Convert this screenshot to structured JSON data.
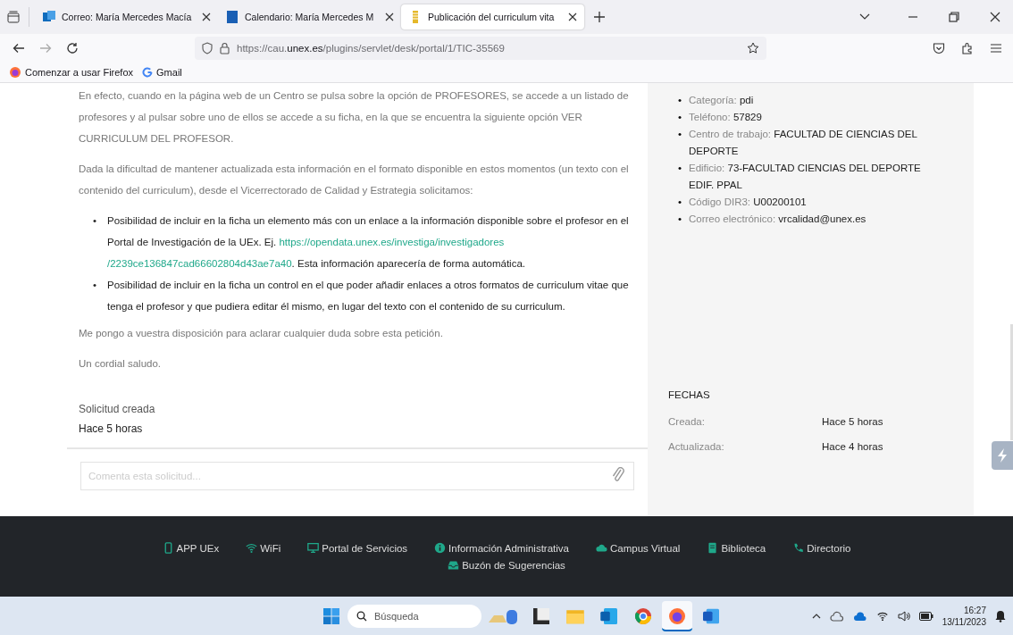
{
  "browser": {
    "tabs": [
      {
        "title": "Correo: María Mercedes Macía",
        "selected": false
      },
      {
        "title": "Calendario: María Mercedes M",
        "selected": false
      },
      {
        "title": "Publicación del curriculum vita",
        "selected": true
      }
    ],
    "url": "https://cau.**unex.es**/plugins/servlet/desk/portal/1/TIC-35569",
    "bookmarks": [
      "Comenzar a usar Firefox",
      "Gmail"
    ]
  },
  "message": {
    "paragraphs_top": [
      "En efecto, cuando en la página web de un Centro se pulsa sobre la opción de PROFESORES, se accede a un listado de profesores y al pulsar sobre uno de ellos se accede a su ficha, en la que se encuentra la siguiente opción VER CURRICULUM DEL PROFESOR.",
      "Dada la dificultad de mantener actualizada esta información en el formato disponible en estos momentos (un texto con el contenido del curriculum), desde el Vicerrectorado de Calidad y Estrategia solicitamos:"
    ],
    "bullet": "•",
    "bullets": [
      {
        "text": "Posibilidad de incluir en la ficha un elemento más con un enlace a la información disponible sobre el profesor en el Portal de Investigación de la UEx. Ej. ",
        "link_lines": [
          "https://opendata.unex.es/investiga/investigadores",
          "/2239ce136847cad66602804d43ae7a40"
        ],
        "after": ". Esta información aparecería de forma automática."
      },
      {
        "text": "Posibilidad de incluir en la ficha un control en el que poder añadir enlaces a otros formatos de curriculum vitae que tenga el profesor y que pudiera editar él mismo, en lugar del texto con el contenido de su curriculum."
      }
    ],
    "paragraphs_bottom": [
      "Me pongo a vuestra disposición para aclarar cualquier duda sobre esta petición.",
      "Un cordial saludo."
    ]
  },
  "status": {
    "label": "Solicitud creada",
    "value": "Hace 5 horas"
  },
  "comment": {
    "placeholder": "Comenta esta solicitud..."
  },
  "details_bullet": "•",
  "details": [
    {
      "label": "Categoría:",
      "value": "pdi"
    },
    {
      "label": "Teléfono:",
      "value": "57829"
    },
    {
      "label": "Centro de trabajo:",
      "value": "FACULTAD DE CIENCIAS DEL DEPORTE"
    },
    {
      "label": "Edificio:",
      "value": "73-FACULTAD CIENCIAS DEL DEPORTE EDIF. PPAL"
    },
    {
      "label": "Código DIR3:",
      "value": "U00200101"
    },
    {
      "label": "Correo electrónico:",
      "value": "vrcalidad@unex.es"
    }
  ],
  "dates": {
    "heading": "FECHAS",
    "rows": [
      {
        "label": "Creada:",
        "value": "Hace 5 horas"
      },
      {
        "label": "Actualizada:",
        "value": "Hace 4 horas"
      }
    ]
  },
  "footer_links": [
    "APP UEx",
    "WiFi",
    "Portal de Servicios",
    "Información Administrativa",
    "Campus Virtual",
    "Biblioteca",
    "Directorio",
    "Buzón de Sugerencias"
  ],
  "taskbar": {
    "search_placeholder": "Búsqueda",
    "apps": [
      {
        "selected": false
      },
      {
        "selected": false
      },
      {
        "selected": false
      },
      {
        "selected": false
      },
      {
        "selected": true
      },
      {
        "selected": false
      }
    ],
    "time": "16:27",
    "date": "13/11/2023"
  }
}
